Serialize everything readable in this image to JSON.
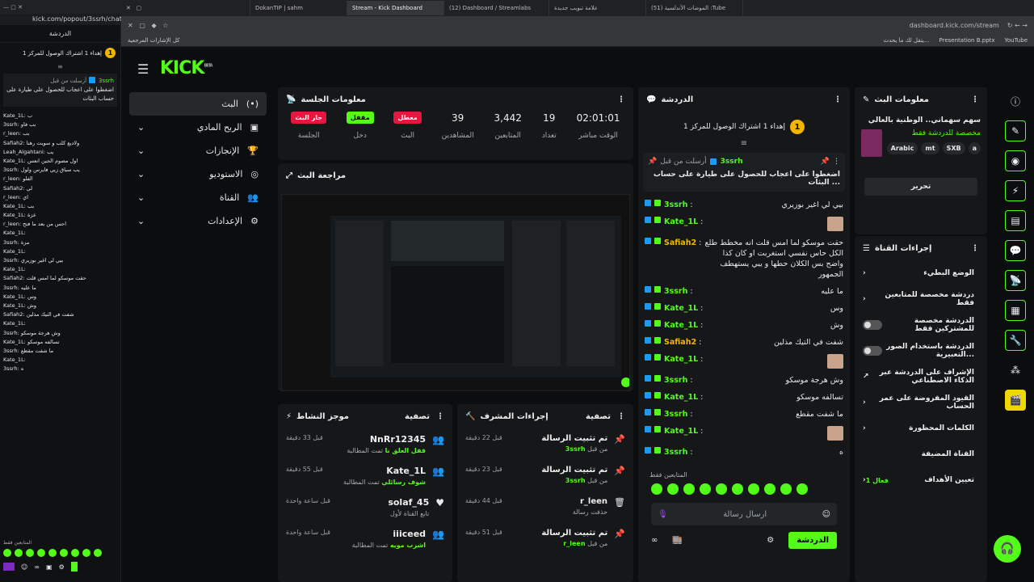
{
  "popout": {
    "url": "kick.com/popout/3ssrh/chat",
    "title": "الدردشة",
    "goal": "إهداء 1 اشتراك الوصول للمركز 1",
    "goal_num": "1",
    "pinned_user": "3ssrh",
    "pinned_meta": "أرسلت من قبل",
    "pinned_text": "اضغطوا على اعجاب للحصول على طيارة على حساب البثات",
    "messages": [
      "Kate_1L: ب",
      "3ssrh: بب فاو",
      "r_leen: بب",
      "Safiah2: ولاديع كلب و سويت رهنا",
      "Leah_Algahtani: يب",
      "Kate_1L: اول مصوم الجين انعس",
      "3ssrh: يب سباق زيي فايرس ولول",
      "r_leen: الفلو",
      "Safiah2: لي",
      "r_leen: اي",
      "Kate_1L: بب",
      "Kate_1L: عزة",
      "r_leen: احس من بعد ما فتح",
      "Kate_1L:",
      "3ssrh: مزة",
      "Kate_1L:",
      "3ssrh: بيي لي اغير بوزيري",
      "Kate_1L:",
      "Safiah2: حقت موسكو لما امس قلت",
      "3ssrh: ما عليه",
      "Kate_1L: وس",
      "Kate_1L: وش",
      "Safiah2: شفت في التيك مذلين",
      "Kate_1L:",
      "3ssrh: وش هرجة موسكو",
      "Kate_1L: تسالفه موسكو",
      "3ssrh: ما شفت مقطع",
      "Kate_1L:",
      "3ssrh: ه"
    ],
    "followers_only": "المتابعين فقط"
  },
  "browser": {
    "tabs": [
      "DokanTIP | sahm",
      "Stream - Kick Dashboard",
      "(12) Dashboard / Streamlabs",
      "علامة تبويب جديدة",
      "(51) الموضات الأندلسية :Tube"
    ],
    "url": "dashboard.kick.com/stream",
    "bookmarks": [
      "كل الإشارات المرجعية",
      "Presentation B.pptx",
      "يتقل لك ما يحدث...",
      "YouTube"
    ]
  },
  "app": {
    "logo": "KICK",
    "logo_beta": "BETA",
    "nav": [
      {
        "label": "البث",
        "icon": "(•)"
      },
      {
        "label": "الربح المادي",
        "icon": "▣"
      },
      {
        "label": "الإنجازات",
        "icon": "🏆"
      },
      {
        "label": "الاستوديو",
        "icon": "◎"
      },
      {
        "label": "القناة",
        "icon": "👥"
      },
      {
        "label": "الإعدادات",
        "icon": "⚙"
      }
    ],
    "session": {
      "title": "معلومات الجلسة",
      "stats": [
        {
          "value": "02:01:01",
          "label": "الوقت مباشر"
        },
        {
          "value": "19",
          "label": "تعداد"
        },
        {
          "value": "3,442",
          "label": "المتابعين"
        },
        {
          "value": "39",
          "label": "المشاهدين"
        }
      ],
      "pills": [
        {
          "text": "معطل",
          "label": "البث"
        },
        {
          "text": "مقفل",
          "label": "دخل"
        },
        {
          "text": "جار البث",
          "label": "الجلسة"
        }
      ]
    },
    "preview_title": "مراجعة البث",
    "activity": {
      "title": "موجز النشاط",
      "filter": "تصفية",
      "items": [
        {
          "name": "NnRr12345",
          "sub": "تمت المطالبة",
          "action": "قفل العلق نا",
          "time": "قبل 33 دقيقة"
        },
        {
          "name": "Kate_1L",
          "sub": "تمت المطالبة",
          "action": "شوف رسائلي",
          "time": "قبل 55 دقيقة"
        },
        {
          "name": "solaf_45",
          "sub": "تابع القناة لأول",
          "action": "",
          "time": "قبل ساعة واحدة"
        },
        {
          "name": "iiiceed",
          "sub": "تمت المطالبة",
          "action": "اشرب مويه",
          "time": "قبل ساعة واحدة"
        }
      ]
    },
    "modactions": {
      "title": "إجراءات المشرف",
      "filter": "تصفية",
      "items": [
        {
          "name": "تم تثبيت الرسالة",
          "sub": "من قبل",
          "user": "3ssrh",
          "time": "قبل 22 دقيقة"
        },
        {
          "name": "تم تثبيت الرسالة",
          "sub": "من قبل",
          "user": "3ssrh",
          "time": "قبل 23 دقيقة"
        },
        {
          "name": "r_leen",
          "sub": "حذفت رسالة",
          "user": "",
          "time": "قبل 44 دقيقة"
        },
        {
          "name": "تم تثبيت الرسالة",
          "sub": "من قبل",
          "user": "r_leen",
          "time": "قبل 51 دقيقة"
        }
      ]
    },
    "chat": {
      "title": "الدردشة",
      "goal": "إهداء 1 اشتراك الوصول للمركز 1",
      "goal_num": "1",
      "pinned_user": "3ssrh",
      "pinned_meta": "أرسلت من قبل",
      "pinned_text": "اضغطوا على اعجاب للحصول على طيارة على حساب البثات ...",
      "messages": [
        {
          "user": "3ssrh",
          "text": "بيي لي اغير بوزيري",
          "color": "#53fc18"
        },
        {
          "user": "Kate_1L",
          "text": "",
          "color": "#53fc18"
        },
        {
          "user": "Safiah2",
          "text": "حقت موسكو لما امس قلت انه مخطط طلع الكل حاس نفسي استغربت او كان كذا واضح بس الكلان حطها و يبي يستهطف الجمهور",
          "color": "#f2b600"
        },
        {
          "user": "3ssrh",
          "text": "ما عليه",
          "color": "#53fc18"
        },
        {
          "user": "Kate_1L",
          "text": "وس",
          "color": "#53fc18"
        },
        {
          "user": "Kate_1L",
          "text": "وش",
          "color": "#53fc18"
        },
        {
          "user": "Safiah2",
          "text": "شفت في التيك مذلين",
          "color": "#f2b600"
        },
        {
          "user": "Kate_1L",
          "text": "",
          "color": "#53fc18"
        },
        {
          "user": "3ssrh",
          "text": "وش هرجة موسكو",
          "color": "#53fc18"
        },
        {
          "user": "Kate_1L",
          "text": "تسالفه موسكو",
          "color": "#53fc18"
        },
        {
          "user": "3ssrh",
          "text": "ما شفت مقطع",
          "color": "#53fc18"
        },
        {
          "user": "Kate_1L",
          "text": "",
          "color": "#53fc18"
        },
        {
          "user": "3ssrh",
          "text": "ه",
          "color": "#53fc18"
        }
      ],
      "followers_only": "المتابعين فقط",
      "input_placeholder": "ارسال رسالة",
      "send_label": "الدردشة"
    },
    "stream_info": {
      "title": "معلومات البث",
      "stream_title": "سهم سهماني.. الوطنية بالعالي",
      "category": "مخصصة للدردشة فقط",
      "tags": [
        "Arabic",
        "mt",
        "SXB",
        "a"
      ],
      "edit_label": "تحرير"
    },
    "channel_actions": {
      "title": "إجراءات القناة",
      "rows": [
        {
          "label": "الوضع البطيء",
          "type": "chevron"
        },
        {
          "label": "دردشة مخصصة للمتابعين فقط",
          "type": "chevron"
        },
        {
          "label": "الدردشة مخصصة للمشتركين فقط",
          "type": "toggle"
        },
        {
          "label": "الدردشة باستخدام الصور التعبيرية...",
          "type": "toggle"
        },
        {
          "label": "الإشراف على الدردشة عبر الذكاء الاصطناعي",
          "type": "link"
        },
        {
          "label": "القيود المفروضة على عمر الحساب",
          "type": "chevron"
        },
        {
          "label": "الكلمات المحظورة",
          "type": "chevron"
        },
        {
          "label": "القناة المضيفة",
          "type": "none"
        },
        {
          "label": "تعيين الأهداف",
          "type": "chevron",
          "status": "فعال 1"
        }
      ]
    }
  }
}
